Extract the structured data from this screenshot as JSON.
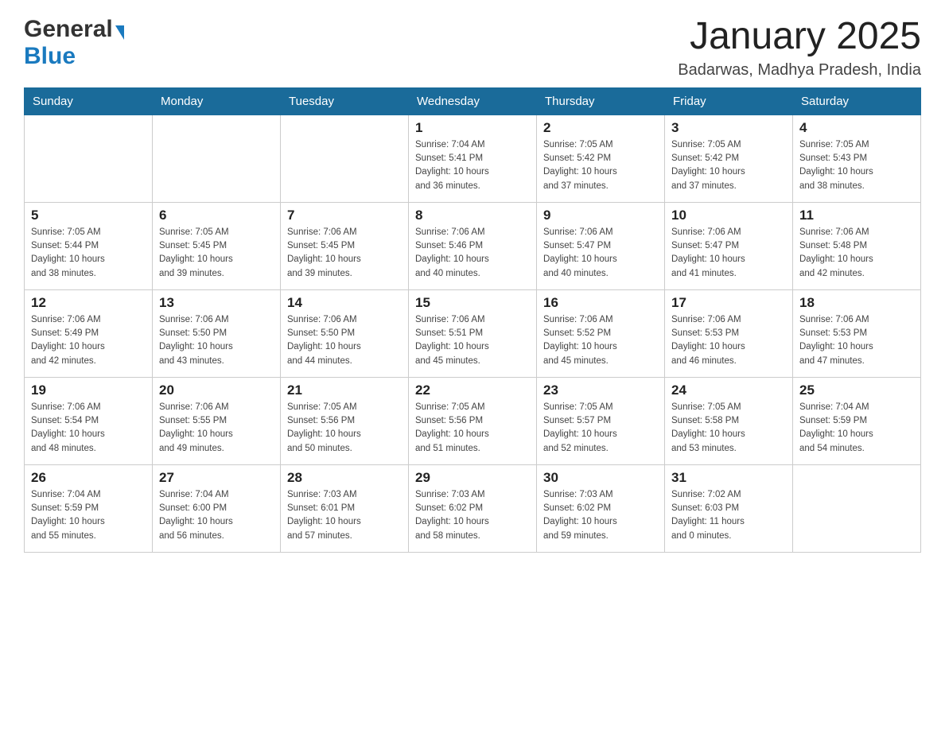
{
  "header": {
    "logo_general": "General",
    "logo_blue": "Blue",
    "title": "January 2025",
    "subtitle": "Badarwas, Madhya Pradesh, India"
  },
  "weekdays": [
    "Sunday",
    "Monday",
    "Tuesday",
    "Wednesday",
    "Thursday",
    "Friday",
    "Saturday"
  ],
  "weeks": [
    [
      {
        "day": "",
        "info": ""
      },
      {
        "day": "",
        "info": ""
      },
      {
        "day": "",
        "info": ""
      },
      {
        "day": "1",
        "info": "Sunrise: 7:04 AM\nSunset: 5:41 PM\nDaylight: 10 hours\nand 36 minutes."
      },
      {
        "day": "2",
        "info": "Sunrise: 7:05 AM\nSunset: 5:42 PM\nDaylight: 10 hours\nand 37 minutes."
      },
      {
        "day": "3",
        "info": "Sunrise: 7:05 AM\nSunset: 5:42 PM\nDaylight: 10 hours\nand 37 minutes."
      },
      {
        "day": "4",
        "info": "Sunrise: 7:05 AM\nSunset: 5:43 PM\nDaylight: 10 hours\nand 38 minutes."
      }
    ],
    [
      {
        "day": "5",
        "info": "Sunrise: 7:05 AM\nSunset: 5:44 PM\nDaylight: 10 hours\nand 38 minutes."
      },
      {
        "day": "6",
        "info": "Sunrise: 7:05 AM\nSunset: 5:45 PM\nDaylight: 10 hours\nand 39 minutes."
      },
      {
        "day": "7",
        "info": "Sunrise: 7:06 AM\nSunset: 5:45 PM\nDaylight: 10 hours\nand 39 minutes."
      },
      {
        "day": "8",
        "info": "Sunrise: 7:06 AM\nSunset: 5:46 PM\nDaylight: 10 hours\nand 40 minutes."
      },
      {
        "day": "9",
        "info": "Sunrise: 7:06 AM\nSunset: 5:47 PM\nDaylight: 10 hours\nand 40 minutes."
      },
      {
        "day": "10",
        "info": "Sunrise: 7:06 AM\nSunset: 5:47 PM\nDaylight: 10 hours\nand 41 minutes."
      },
      {
        "day": "11",
        "info": "Sunrise: 7:06 AM\nSunset: 5:48 PM\nDaylight: 10 hours\nand 42 minutes."
      }
    ],
    [
      {
        "day": "12",
        "info": "Sunrise: 7:06 AM\nSunset: 5:49 PM\nDaylight: 10 hours\nand 42 minutes."
      },
      {
        "day": "13",
        "info": "Sunrise: 7:06 AM\nSunset: 5:50 PM\nDaylight: 10 hours\nand 43 minutes."
      },
      {
        "day": "14",
        "info": "Sunrise: 7:06 AM\nSunset: 5:50 PM\nDaylight: 10 hours\nand 44 minutes."
      },
      {
        "day": "15",
        "info": "Sunrise: 7:06 AM\nSunset: 5:51 PM\nDaylight: 10 hours\nand 45 minutes."
      },
      {
        "day": "16",
        "info": "Sunrise: 7:06 AM\nSunset: 5:52 PM\nDaylight: 10 hours\nand 45 minutes."
      },
      {
        "day": "17",
        "info": "Sunrise: 7:06 AM\nSunset: 5:53 PM\nDaylight: 10 hours\nand 46 minutes."
      },
      {
        "day": "18",
        "info": "Sunrise: 7:06 AM\nSunset: 5:53 PM\nDaylight: 10 hours\nand 47 minutes."
      }
    ],
    [
      {
        "day": "19",
        "info": "Sunrise: 7:06 AM\nSunset: 5:54 PM\nDaylight: 10 hours\nand 48 minutes."
      },
      {
        "day": "20",
        "info": "Sunrise: 7:06 AM\nSunset: 5:55 PM\nDaylight: 10 hours\nand 49 minutes."
      },
      {
        "day": "21",
        "info": "Sunrise: 7:05 AM\nSunset: 5:56 PM\nDaylight: 10 hours\nand 50 minutes."
      },
      {
        "day": "22",
        "info": "Sunrise: 7:05 AM\nSunset: 5:56 PM\nDaylight: 10 hours\nand 51 minutes."
      },
      {
        "day": "23",
        "info": "Sunrise: 7:05 AM\nSunset: 5:57 PM\nDaylight: 10 hours\nand 52 minutes."
      },
      {
        "day": "24",
        "info": "Sunrise: 7:05 AM\nSunset: 5:58 PM\nDaylight: 10 hours\nand 53 minutes."
      },
      {
        "day": "25",
        "info": "Sunrise: 7:04 AM\nSunset: 5:59 PM\nDaylight: 10 hours\nand 54 minutes."
      }
    ],
    [
      {
        "day": "26",
        "info": "Sunrise: 7:04 AM\nSunset: 5:59 PM\nDaylight: 10 hours\nand 55 minutes."
      },
      {
        "day": "27",
        "info": "Sunrise: 7:04 AM\nSunset: 6:00 PM\nDaylight: 10 hours\nand 56 minutes."
      },
      {
        "day": "28",
        "info": "Sunrise: 7:03 AM\nSunset: 6:01 PM\nDaylight: 10 hours\nand 57 minutes."
      },
      {
        "day": "29",
        "info": "Sunrise: 7:03 AM\nSunset: 6:02 PM\nDaylight: 10 hours\nand 58 minutes."
      },
      {
        "day": "30",
        "info": "Sunrise: 7:03 AM\nSunset: 6:02 PM\nDaylight: 10 hours\nand 59 minutes."
      },
      {
        "day": "31",
        "info": "Sunrise: 7:02 AM\nSunset: 6:03 PM\nDaylight: 11 hours\nand 0 minutes."
      },
      {
        "day": "",
        "info": ""
      }
    ]
  ]
}
